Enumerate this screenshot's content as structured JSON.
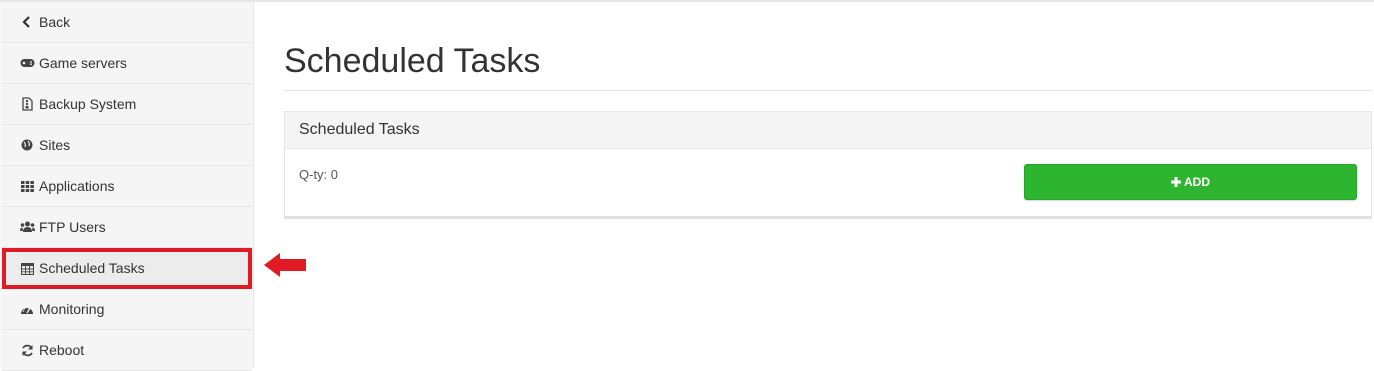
{
  "sidebar": {
    "items": [
      {
        "label": "Back",
        "icon": "chevron-left-icon"
      },
      {
        "label": "Game servers",
        "icon": "gamepad-icon"
      },
      {
        "label": "Backup System",
        "icon": "file-archive-icon"
      },
      {
        "label": "Sites",
        "icon": "globe-icon"
      },
      {
        "label": "Applications",
        "icon": "grid-icon"
      },
      {
        "label": "FTP Users",
        "icon": "users-icon"
      },
      {
        "label": "Scheduled Tasks",
        "icon": "calendar-icon",
        "active": true
      },
      {
        "label": "Monitoring",
        "icon": "dashboard-icon"
      },
      {
        "label": "Reboot",
        "icon": "refresh-icon"
      }
    ]
  },
  "main": {
    "title": "Scheduled Tasks",
    "panel": {
      "heading": "Scheduled Tasks",
      "quantity_text": "Q-ty: 0",
      "add_label": "ADD"
    }
  },
  "colors": {
    "highlight_red": "#e01b24",
    "add_green": "#2db530"
  }
}
